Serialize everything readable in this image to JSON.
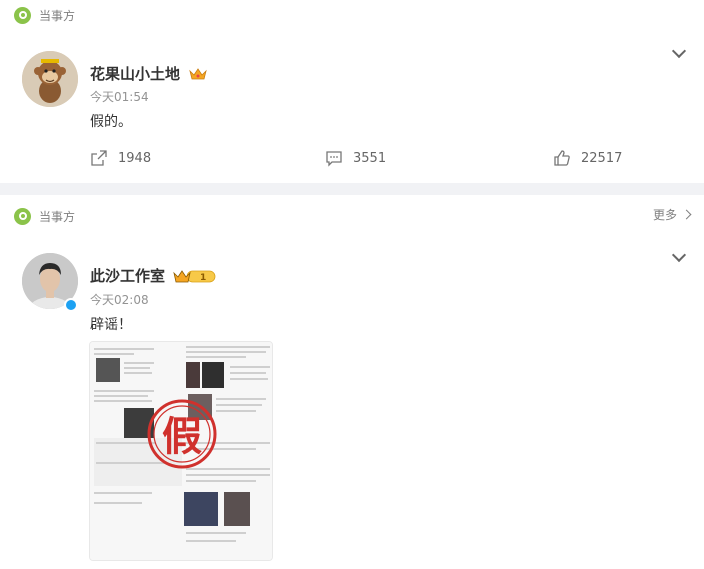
{
  "posts": [
    {
      "topic": "当事方",
      "author": "花果山小土地",
      "time": "今天01:54",
      "text": "假的。",
      "actions": {
        "share": "1948",
        "comment": "3551",
        "like": "22517"
      }
    },
    {
      "topic": "当事方",
      "more": "更多",
      "author": "此沙工作室",
      "time": "今天02:08",
      "text": "辟谣！",
      "image_stamp": "假",
      "badge_level": "1"
    }
  ],
  "colors": {
    "topic_icon": "#8bc34a",
    "verified": "#1da1f2",
    "stamp": "#d0312d"
  }
}
